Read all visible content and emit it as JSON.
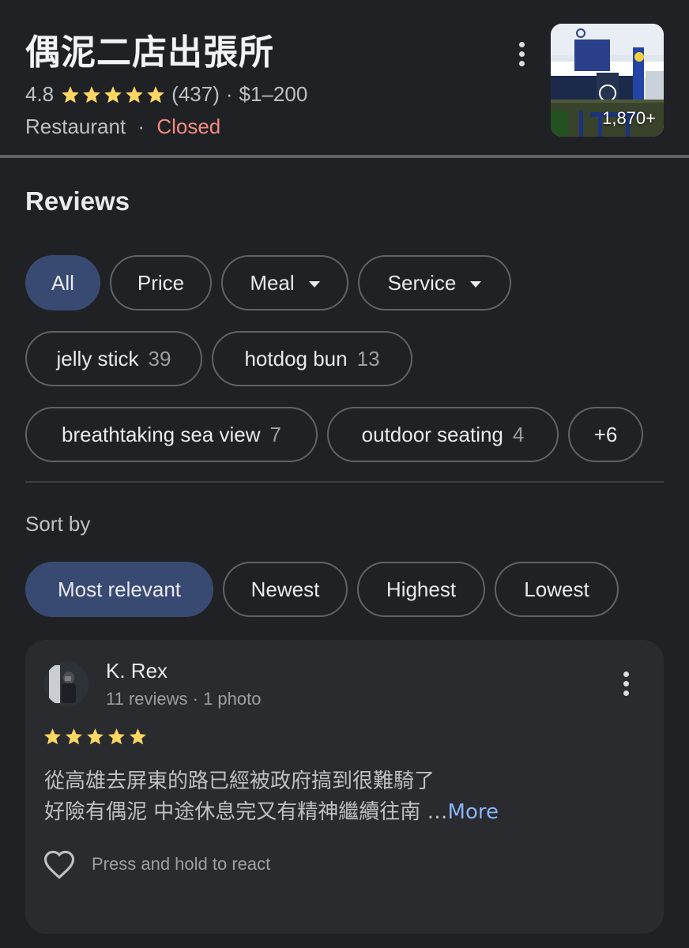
{
  "place": {
    "name": "偶泥二店出張所",
    "rating": "4.8",
    "stars": 5,
    "review_count": "(437)",
    "price": "$1–200",
    "category": "Restaurant",
    "status": "Closed",
    "photo_count": "1,870+"
  },
  "reviews_section": {
    "title": "Reviews",
    "filters": [
      {
        "label": "All",
        "selected": true
      },
      {
        "label": "Price"
      },
      {
        "label": "Meal",
        "dropdown": true
      },
      {
        "label": "Service",
        "dropdown": true
      }
    ],
    "topics": [
      {
        "label": "jelly stick",
        "count": "39"
      },
      {
        "label": "hotdog bun",
        "count": "13"
      },
      {
        "label": "breathtaking sea view",
        "count": "7"
      },
      {
        "label": "outdoor seating",
        "count": "4"
      }
    ],
    "more_topics": "+6",
    "sort_label": "Sort by",
    "sort_options": [
      {
        "label": "Most relevant",
        "selected": true
      },
      {
        "label": "Newest"
      },
      {
        "label": "Highest"
      },
      {
        "label": "Lowest"
      }
    ]
  },
  "review": {
    "author": "K. Rex",
    "meta": "11 reviews · 1 photo",
    "stars": 5,
    "line1": "從高雄去屏東的路已經被政府搞到很難騎了",
    "line2": "好險有偶泥 中途休息完又有精神繼續往南 …",
    "more_label": "More",
    "react_label": "Press and hold to react"
  },
  "colors": {
    "background": "#202124",
    "selected_chip": "#394a72",
    "star": "#fdd663",
    "closed": "#f28b82",
    "link": "#8ab4f8"
  }
}
